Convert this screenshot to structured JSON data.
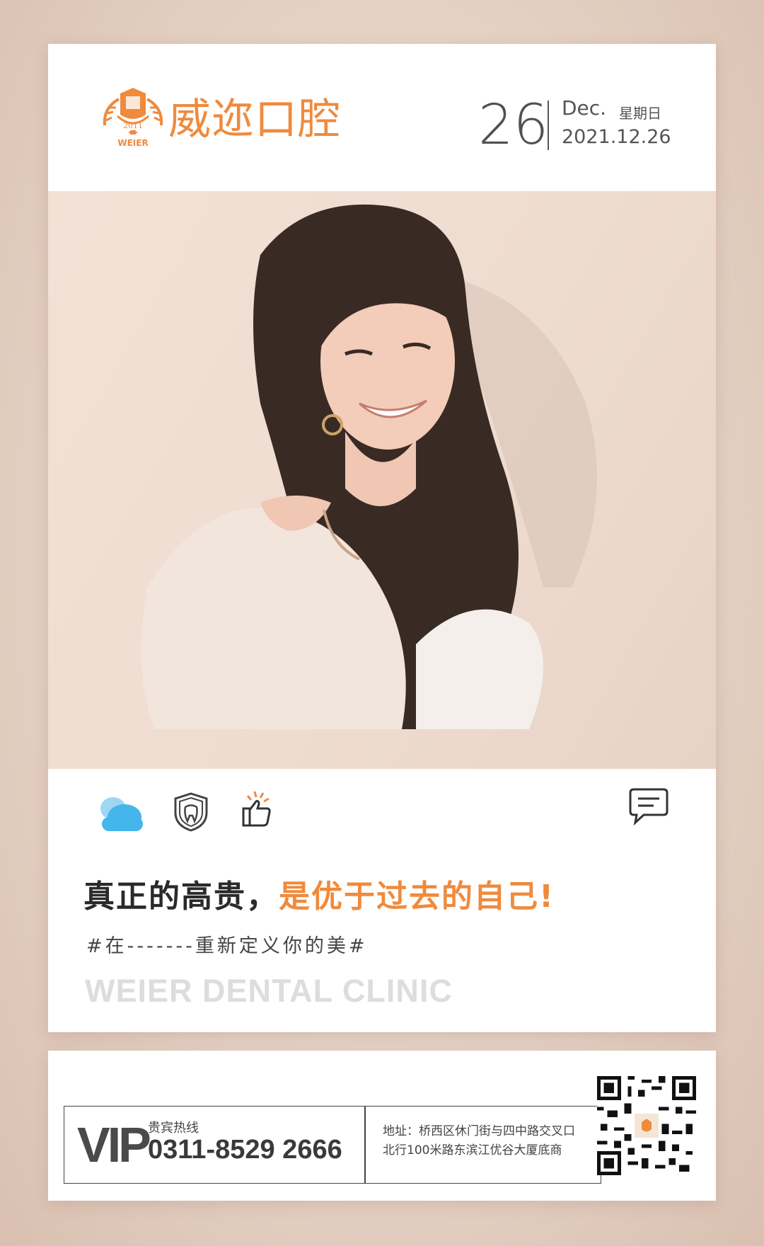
{
  "brand": {
    "name": "威迩口腔",
    "emblem_year": "2011",
    "emblem_text": "WEIER",
    "accent_color": "#f08a3c"
  },
  "date": {
    "day": "26",
    "month": "Dec.",
    "weekday": "星期日",
    "full": "2021.12.26"
  },
  "icons": [
    "cloud-icon",
    "tooth-shield-icon",
    "thumbs-up-icon",
    "comment-icon"
  ],
  "headline": {
    "part1": "真正的高贵，",
    "part2": "是优于过去的自己!"
  },
  "tagline": "#在-------重新定义你的美#",
  "watermark": "WEIER DENTAL CLINIC",
  "footer": {
    "vip": "VIP",
    "hotline_label": "贵宾热线",
    "hotline_number": "0311-8529 2666",
    "address_line1": "地址：桥西区休门街与四中路交叉口",
    "address_line2": "北行100米路东滨江优谷大厦底商"
  }
}
